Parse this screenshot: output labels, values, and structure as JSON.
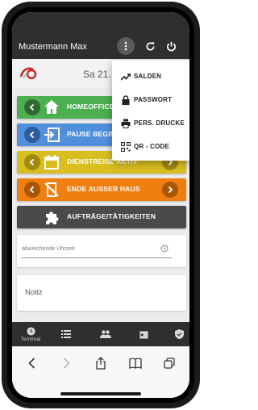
{
  "header": {
    "user_name": "Mustermann Max",
    "bg_color": "#2f2f2f"
  },
  "date": {
    "text": "Sa 21."
  },
  "actions": [
    {
      "label": "HOMEOFFICE",
      "color": "#4caf50",
      "icon": "home-icon"
    },
    {
      "label": "PAUSE BEGINN",
      "color": "#4f8fdc",
      "icon": "enter-arrow-icon"
    },
    {
      "label": "DIENSTREISE AKTIV",
      "color": "#d9be1f",
      "icon": "calendar-icon"
    },
    {
      "label": "ENDE AUSSER HAUS",
      "color": "#f07f12",
      "icon": "door-crossed-icon"
    },
    {
      "label": "AUFTRÄGE/TÄTIGKEITEN",
      "color": "#4a4a4a",
      "icon": "puzzle-icon"
    }
  ],
  "time_input": {
    "placeholder": "abweichende Uhrzeit"
  },
  "note_input": {
    "placeholder": "Notiz"
  },
  "menu": {
    "items": [
      {
        "label": "SALDEN",
        "icon": "trend-icon"
      },
      {
        "label": "PASSWORT",
        "icon": "lock-icon"
      },
      {
        "label": "PERS. DRUCKE",
        "icon": "printer-icon"
      },
      {
        "label": "QR - CODE",
        "icon": "qr-code-icon"
      }
    ]
  },
  "bottom_nav": {
    "items": [
      {
        "label": "Terminal",
        "icon": "clock-icon"
      },
      {
        "label": "",
        "icon": "list-icon"
      },
      {
        "label": "",
        "icon": "people-icon"
      },
      {
        "label": "",
        "icon": "calendar-icon"
      },
      {
        "label": "",
        "icon": "shield-check-icon"
      }
    ]
  },
  "browser": {
    "icons": [
      "back-icon",
      "forward-icon",
      "share-icon",
      "bookmarks-icon",
      "tabs-icon"
    ]
  }
}
